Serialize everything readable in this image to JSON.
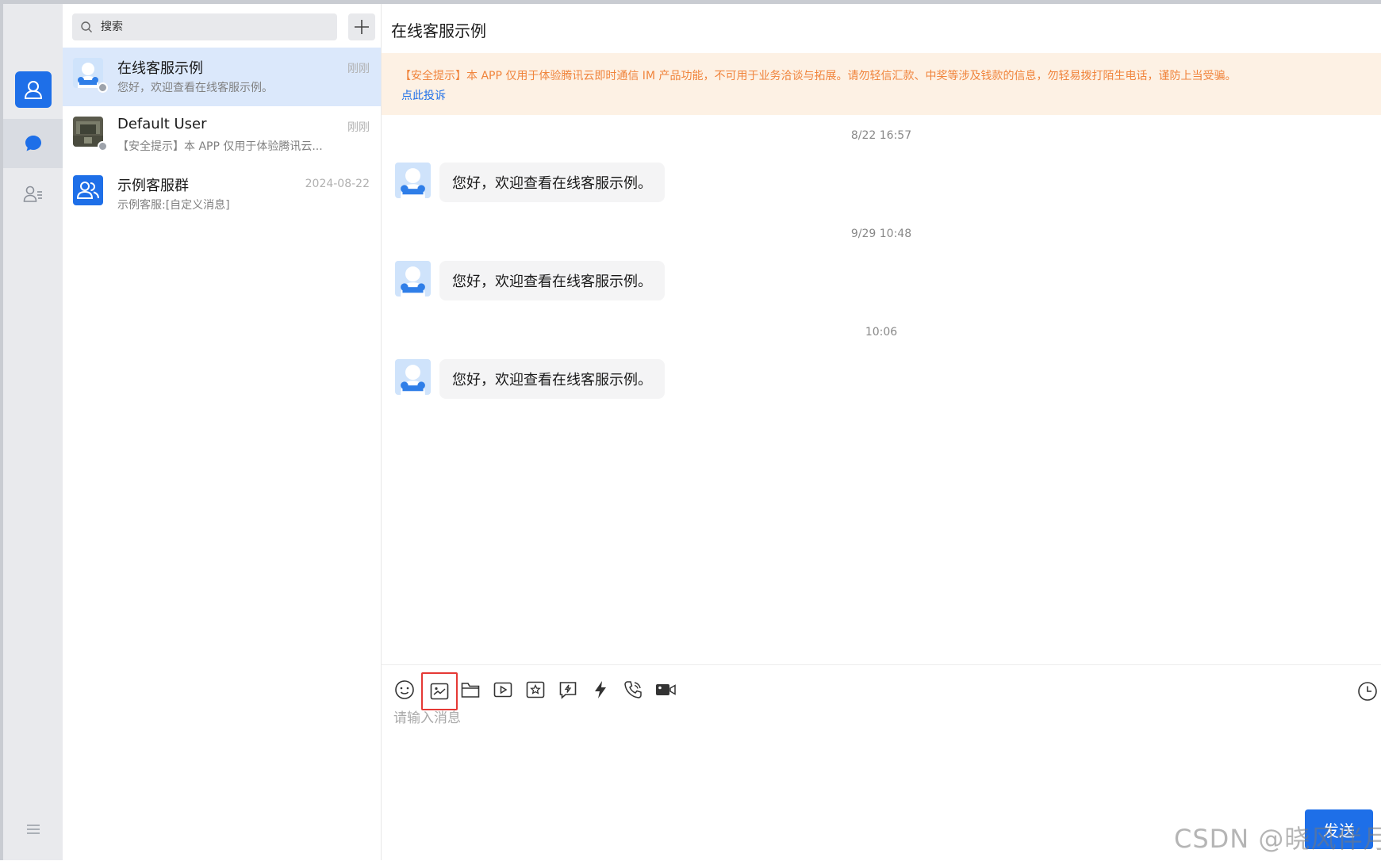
{
  "search": {
    "placeholder": "搜索"
  },
  "conversations": [
    {
      "name": "在线客服示例",
      "preview": "您好，欢迎查看在线客服示例。",
      "time": "刚刚",
      "active": true
    },
    {
      "name": "Default User",
      "preview": "【安全提示】本 APP 仅用于体验腾讯云...",
      "time": "刚刚",
      "active": false
    },
    {
      "name": "示例客服群",
      "preview": "示例客服:[自定义消息]",
      "time": "2024-08-22",
      "active": false
    }
  ],
  "chat": {
    "title": "在线客服示例",
    "warning_text": "【安全提示】本 APP 仅用于体验腾讯云即时通信 IM 产品功能，不可用于业务洽谈与拓展。请勿轻信汇款、中奖等涉及钱款的信息，勿轻易拨打陌生电话，谨防上当受骗。",
    "warning_link": "点此投诉",
    "messages": [
      {
        "timestamp": "8/22 16:57",
        "text": "您好，欢迎查看在线客服示例。"
      },
      {
        "timestamp": "9/29 10:48",
        "text": "您好，欢迎查看在线客服示例。"
      },
      {
        "timestamp": "10:06",
        "text": "您好，欢迎查看在线客服示例。"
      }
    ]
  },
  "composer": {
    "tools": [
      "emoji-icon",
      "image-icon",
      "folder-icon",
      "video-icon",
      "favorite-icon",
      "flash-message-icon",
      "lightning-icon",
      "voice-call-icon",
      "video-call-icon"
    ],
    "placeholder": "请输入消息",
    "send_label": "发送"
  },
  "watermark": "CSDN @晓风伴月",
  "colors": {
    "accent": "#1e6fe8",
    "warning_bg": "#fdf1e4",
    "warning_text": "#f0843c",
    "highlight": "#e53935"
  }
}
